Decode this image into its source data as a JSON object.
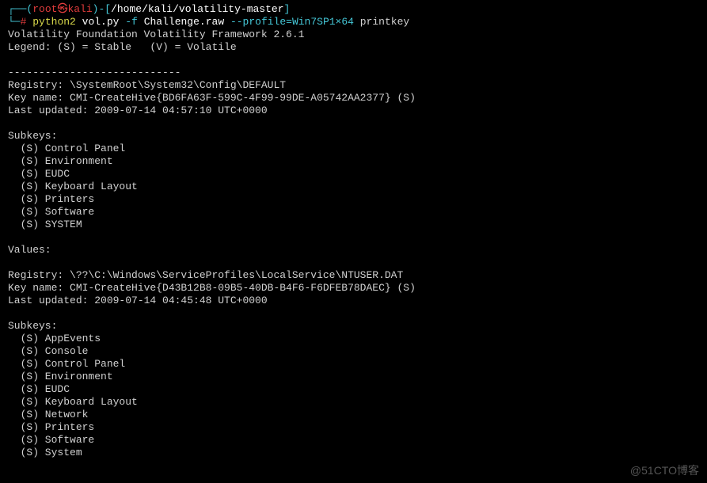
{
  "prompt": {
    "line1_open": "┌──(",
    "user": "root",
    "symbol": "㉿",
    "host": "kali",
    "line1_mid": ")-[",
    "cwd": "/home/kali/volatility-master",
    "line1_close": "]",
    "line2_open": "└─",
    "hash": "#",
    "cmd_interp": "python2",
    "cmd_script": "vol.py",
    "flag_f": "-f",
    "arg_file": "Challenge.raw",
    "profile_flag": "--profile=Win7SP1×64",
    "cmd_plugin": "printkey"
  },
  "output": {
    "banner": "Volatility Foundation Volatility Framework 2.6.1",
    "legend": "Legend: (S) = Stable   (V) = Volatile",
    "sep": "----------------------------",
    "reg1_line": "Registry: \\SystemRoot\\System32\\Config\\DEFAULT",
    "key1_line": "Key name: CMI-CreateHive{BD6FA63F-599C-4F99-99DE-A05742AA2377} (S)",
    "last1_line": "Last updated: 2009-07-14 04:57:10 UTC+0000",
    "subkeys_hdr": "Subkeys:",
    "subkeys1": [
      "  (S) Control Panel",
      "  (S) Environment",
      "  (S) EUDC",
      "  (S) Keyboard Layout",
      "  (S) Printers",
      "  (S) Software",
      "  (S) SYSTEM"
    ],
    "values_hdr": "Values:",
    "reg2_line": "Registry: \\??\\C:\\Windows\\ServiceProfiles\\LocalService\\NTUSER.DAT",
    "key2_line": "Key name: CMI-CreateHive{D43B12B8-09B5-40DB-B4F6-F6DFEB78DAEC} (S)",
    "last2_line": "Last updated: 2009-07-14 04:45:48 UTC+0000",
    "subkeys2": [
      "  (S) AppEvents",
      "  (S) Console",
      "  (S) Control Panel",
      "  (S) Environment",
      "  (S) EUDC",
      "  (S) Keyboard Layout",
      "  (S) Network",
      "  (S) Printers",
      "  (S) Software",
      "  (S) System"
    ]
  },
  "watermark": "@51CTO博客"
}
